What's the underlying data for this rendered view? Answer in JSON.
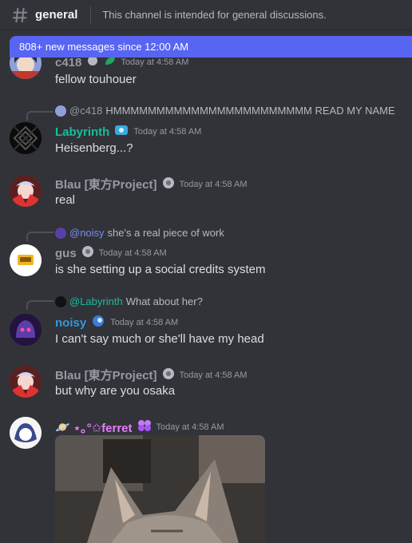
{
  "header": {
    "channel_name": "general",
    "topic": "This channel is intended for general discussions."
  },
  "banner": {
    "text": "808+ new messages since 12:00 AM"
  },
  "messages": [
    {
      "author": "c418",
      "author_color": "#949ba4",
      "time": "Today at 4:58 AM",
      "text": "fellow touhouer"
    },
    {
      "reply_to": "@c418",
      "reply_text": "HMMMMMMMMMMMMMMMMMMMMMMM READ MY NAME",
      "author": "Labyrinth",
      "author_color": "#1abc9c",
      "time": "Today at 4:58 AM",
      "text": "Heisenberg...?"
    },
    {
      "author": "Blau [東方Project]",
      "author_color": "#949ba4",
      "time": "Today at 4:58 AM",
      "text": "real"
    },
    {
      "reply_to": "@noisy",
      "reply_text": "she's a real piece of work",
      "author": "gus",
      "author_color": "#949ba4",
      "time": "Today at 4:58 AM",
      "text": "is she setting up a social credits system"
    },
    {
      "reply_to": "@Labyrinth",
      "reply_text": "What about her?",
      "author": "noisy",
      "author_color": "#3498db",
      "time": "Today at 4:58 AM",
      "text": "I can't say much or she'll have my head"
    },
    {
      "author": "Blau [東方Project]",
      "author_color": "#949ba4",
      "time": "Today at 4:58 AM",
      "text": "but why are you osaka"
    },
    {
      "author_prefix": "🪐",
      "author": "⋆｡°✩ferret",
      "author_color": "#e87dff",
      "time": "Today at 4:58 AM"
    }
  ],
  "colors": {
    "background": "#313338",
    "banner": "#5865f2",
    "timestamp": "#949ba4",
    "message_text": "#dbdee1"
  }
}
